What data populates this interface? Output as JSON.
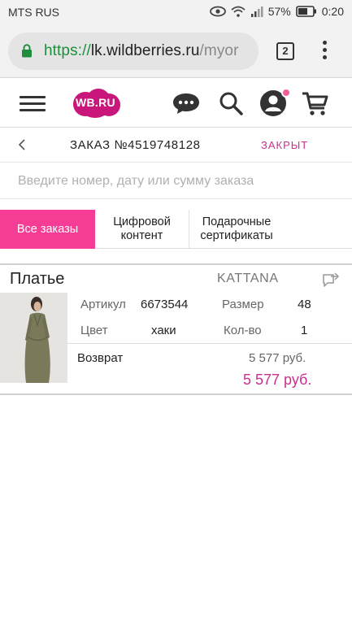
{
  "status_bar": {
    "carrier": "MTS RUS",
    "battery": "57%",
    "time": "0:20"
  },
  "browser": {
    "url_scheme": "https://",
    "url_host": "lk.wildberries.ru",
    "url_path": "/myor",
    "tab_count": "2"
  },
  "site": {
    "logo_text": "WB.RU"
  },
  "order": {
    "title": "ЗАКАЗ №4519748128",
    "status": "ЗАКРЫТ"
  },
  "search": {
    "placeholder": "Введите номер, дату или сумму заказа"
  },
  "tabs": [
    {
      "label": "Все заказы"
    },
    {
      "label": "Цифровой\nконтент"
    },
    {
      "label": "Подарочные\nсертификаты"
    }
  ],
  "product": {
    "name": "Платье",
    "brand": "KATTANA",
    "article_label": "Артикул",
    "article_value": "6673544",
    "size_label": "Размер",
    "size_value": "48",
    "color_label": "Цвет",
    "color_value": "хаки",
    "qty_label": "Кол-во",
    "qty_value": "1",
    "return_label": "Возврат",
    "return_price": "5 577 руб.",
    "total_price": "5 577 руб."
  },
  "colors": {
    "accent": "#f63c94",
    "status": "#cb2f8e",
    "brand": "#c8167a",
    "url_secure": "#1e8e3e"
  },
  "icons": [
    "lock-icon",
    "chat-icon",
    "search-icon",
    "account-icon",
    "cart-icon",
    "back-chevron-icon",
    "share-icon",
    "eye-icon",
    "wifi-icon",
    "signal-icon",
    "battery-icon"
  ]
}
